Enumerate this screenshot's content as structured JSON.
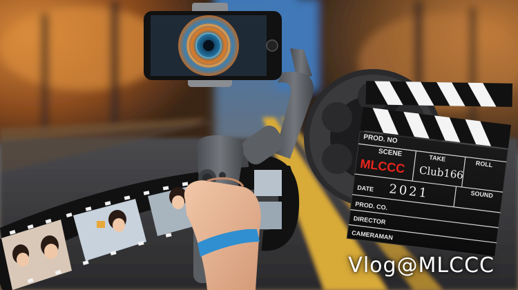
{
  "image": {
    "caption": "Vlog@MLCCC"
  },
  "clapperboard": {
    "prod_no_label": "PROD. NO",
    "scene_label": "SCENE",
    "take_label": "TAKE",
    "roll_label": "ROLL",
    "scene_value": "MLCCC",
    "take_value": "Club166",
    "sound_label": "SOUND",
    "date_label": "DATE",
    "date_value": "2021",
    "prod_co_label": "PROD. CO.",
    "director_label": "DIRECTOR",
    "cameraman_label": "CAMERAMAN",
    "scene_value_color": "#e8241c"
  },
  "colors": {
    "sky": "#2f6fb3",
    "foliage": "#c0702a",
    "road": "#3a3a3d",
    "road_line": "#e0b23a",
    "gimbal": "#5c5f63",
    "wrist_band": "#2f8fd0"
  }
}
